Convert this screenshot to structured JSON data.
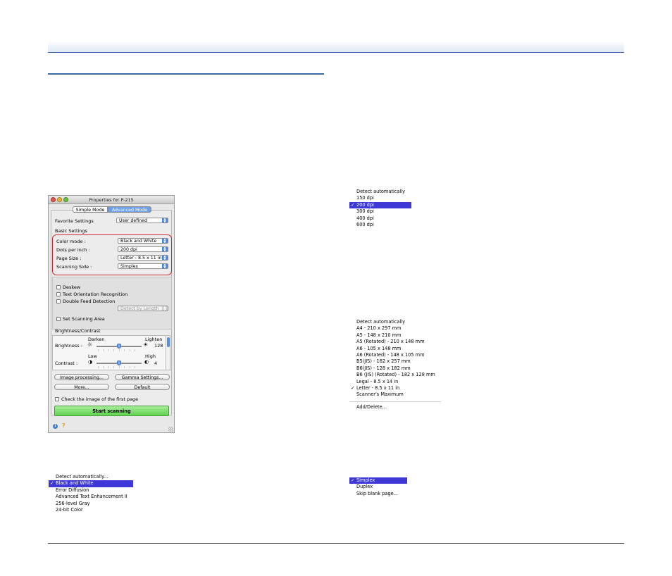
{
  "dialog": {
    "title": "Properties for P-215",
    "modes": [
      "Simple Mode",
      "Advanced Mode"
    ],
    "favorite_label": "Favorite Settings",
    "favorite_value": "User defined",
    "basic_settings_label": "Basic Settings",
    "color_mode_label": "Color mode :",
    "color_mode_value": "Black and White",
    "dpi_label": "Dots per inch :",
    "dpi_value": "200 dpi",
    "page_size_label": "Page Size :",
    "page_size_value": "Letter - 8.5 x 11 in",
    "side_label": "Scanning Side :",
    "side_value": "Simplex",
    "deskew": "Deskew",
    "text_orientation": "Text Orientation Recognition",
    "double_feed": "Double Feed Detection",
    "detect_by_length": "Detect by Length",
    "set_scanning_area": "Set Scanning Area",
    "brightness_contrast_label": "Brightness/Contrast",
    "darken": "Darken",
    "lighten": "Lighten",
    "brightness_label": "Brightness :",
    "brightness_value": "128",
    "low": "Low",
    "high": "High",
    "contrast_label": "Contrast :",
    "contrast_value": "4",
    "brightness_level": 0.5,
    "contrast_level": 0.5,
    "image_processing": "Image processing...",
    "gamma_settings": "Gamma Settings...",
    "more": "More...",
    "default": "Default",
    "check_first_page": "Check the image of the first page",
    "start_scanning": "Start scanning",
    "colors": {
      "highlight": "#3d38d6",
      "outline": "#d0262b",
      "start": "#5fd44e"
    },
    "icons": [
      "info-icon",
      "help-icon"
    ]
  },
  "menus": {
    "color_mode": [
      "Detect automatically...",
      "Black and White",
      "Error Diffusion",
      "Advanced Text Enhancement II",
      "256-level Gray",
      "24-bit Color"
    ],
    "dpi": [
      "Detect automatically",
      "150 dpi",
      "200 dpi",
      "300 dpi",
      "400 dpi",
      "600 dpi"
    ],
    "page_size": [
      "Detect automatically",
      "A4 - 210 x 297 mm",
      "A5 - 148 x 210 mm",
      "A5 (Rotated) - 210 x 148 mm",
      "A6 - 105 x 148 mm",
      "A6 (Rotated) - 148 x 105 mm",
      "B5(JIS) - 182 x 257 mm",
      "B6(JIS) - 128 x 182 mm",
      "B6 (JIS) (Rotated) - 182 x 128 mm",
      "Legal - 8.5 x 14 in",
      "Letter - 8.5 x 11 in",
      "Scanner's Maximum",
      "Add/Delete..."
    ],
    "side": [
      "Simplex",
      "Duplex",
      "Skip blank page..."
    ],
    "check": "✓"
  }
}
